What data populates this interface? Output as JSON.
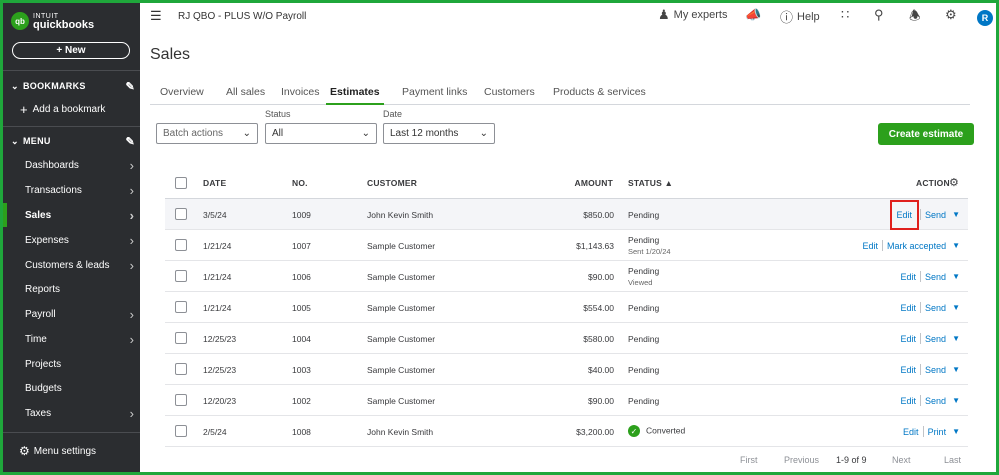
{
  "brand": {
    "logo_mark": "qb",
    "line1": "INTUIT",
    "line2": "quickbooks"
  },
  "sidebar": {
    "new_label": "+ New",
    "bookmarks_title": "BOOKMARKS",
    "add_bookmark": "Add a bookmark",
    "menu_title": "MENU",
    "items": [
      {
        "label": "Dashboards",
        "arrow": true
      },
      {
        "label": "Transactions",
        "arrow": true
      },
      {
        "label": "Sales",
        "arrow": true,
        "active": true
      },
      {
        "label": "Expenses",
        "arrow": true
      },
      {
        "label": "Customers & leads",
        "arrow": true
      },
      {
        "label": "Reports",
        "arrow": false
      },
      {
        "label": "Payroll",
        "arrow": true
      },
      {
        "label": "Time",
        "arrow": true
      },
      {
        "label": "Projects",
        "arrow": false
      },
      {
        "label": "Budgets",
        "arrow": false
      },
      {
        "label": "Taxes",
        "arrow": true
      }
    ],
    "menu_settings": "Menu settings"
  },
  "topbar": {
    "company": "RJ QBO - PLUS W/O Payroll",
    "my_experts": "My experts",
    "help": "Help",
    "avatar": "R"
  },
  "page_title": "Sales",
  "tabs": [
    "Overview",
    "All sales",
    "Invoices",
    "Estimates",
    "Payment links",
    "Customers",
    "Products & services"
  ],
  "active_tab": "Estimates",
  "filters": {
    "batch_actions": "Batch actions",
    "status_label": "Status",
    "status_value": "All",
    "date_label": "Date",
    "date_value": "Last 12 months"
  },
  "create_button": "Create estimate",
  "table": {
    "headers": {
      "date": "DATE",
      "no": "NO.",
      "customer": "CUSTOMER",
      "amount": "AMOUNT",
      "status": "STATUS ▲",
      "action": "ACTION"
    },
    "rows": [
      {
        "date": "3/5/24",
        "no": "1009",
        "customer": "John Kevin Smith",
        "amount": "$850.00",
        "status": "Pending",
        "sub": "",
        "action1": "Edit",
        "action2": "Send"
      },
      {
        "date": "1/21/24",
        "no": "1007",
        "customer": "Sample Customer",
        "amount": "$1,143.63",
        "status": "Pending",
        "sub": "Sent 1/20/24",
        "action1": "Edit",
        "action2": "Mark accepted"
      },
      {
        "date": "1/21/24",
        "no": "1006",
        "customer": "Sample Customer",
        "amount": "$90.00",
        "status": "Pending",
        "sub": "Viewed",
        "action1": "Edit",
        "action2": "Send"
      },
      {
        "date": "1/21/24",
        "no": "1005",
        "customer": "Sample Customer",
        "amount": "$554.00",
        "status": "Pending",
        "sub": "",
        "action1": "Edit",
        "action2": "Send"
      },
      {
        "date": "12/25/23",
        "no": "1004",
        "customer": "Sample Customer",
        "amount": "$580.00",
        "status": "Pending",
        "sub": "",
        "action1": "Edit",
        "action2": "Send"
      },
      {
        "date": "12/25/23",
        "no": "1003",
        "customer": "Sample Customer",
        "amount": "$40.00",
        "status": "Pending",
        "sub": "",
        "action1": "Edit",
        "action2": "Send"
      },
      {
        "date": "12/20/23",
        "no": "1002",
        "customer": "Sample Customer",
        "amount": "$90.00",
        "status": "Pending",
        "sub": "",
        "action1": "Edit",
        "action2": "Send"
      },
      {
        "date": "2/5/24",
        "no": "1008",
        "customer": "John Kevin Smith",
        "amount": "$3,200.00",
        "status": "Converted",
        "sub": "",
        "action1": "Edit",
        "action2": "Print"
      }
    ]
  },
  "pager": {
    "first": "First",
    "previous": "Previous",
    "count": "1-9 of 9",
    "next": "Next",
    "last": "Last"
  },
  "colors": {
    "accent_green": "#2ca01c",
    "link_blue": "#0077c5",
    "sidebar_bg": "#2b2d30",
    "highlight_red": "#e0201d"
  }
}
